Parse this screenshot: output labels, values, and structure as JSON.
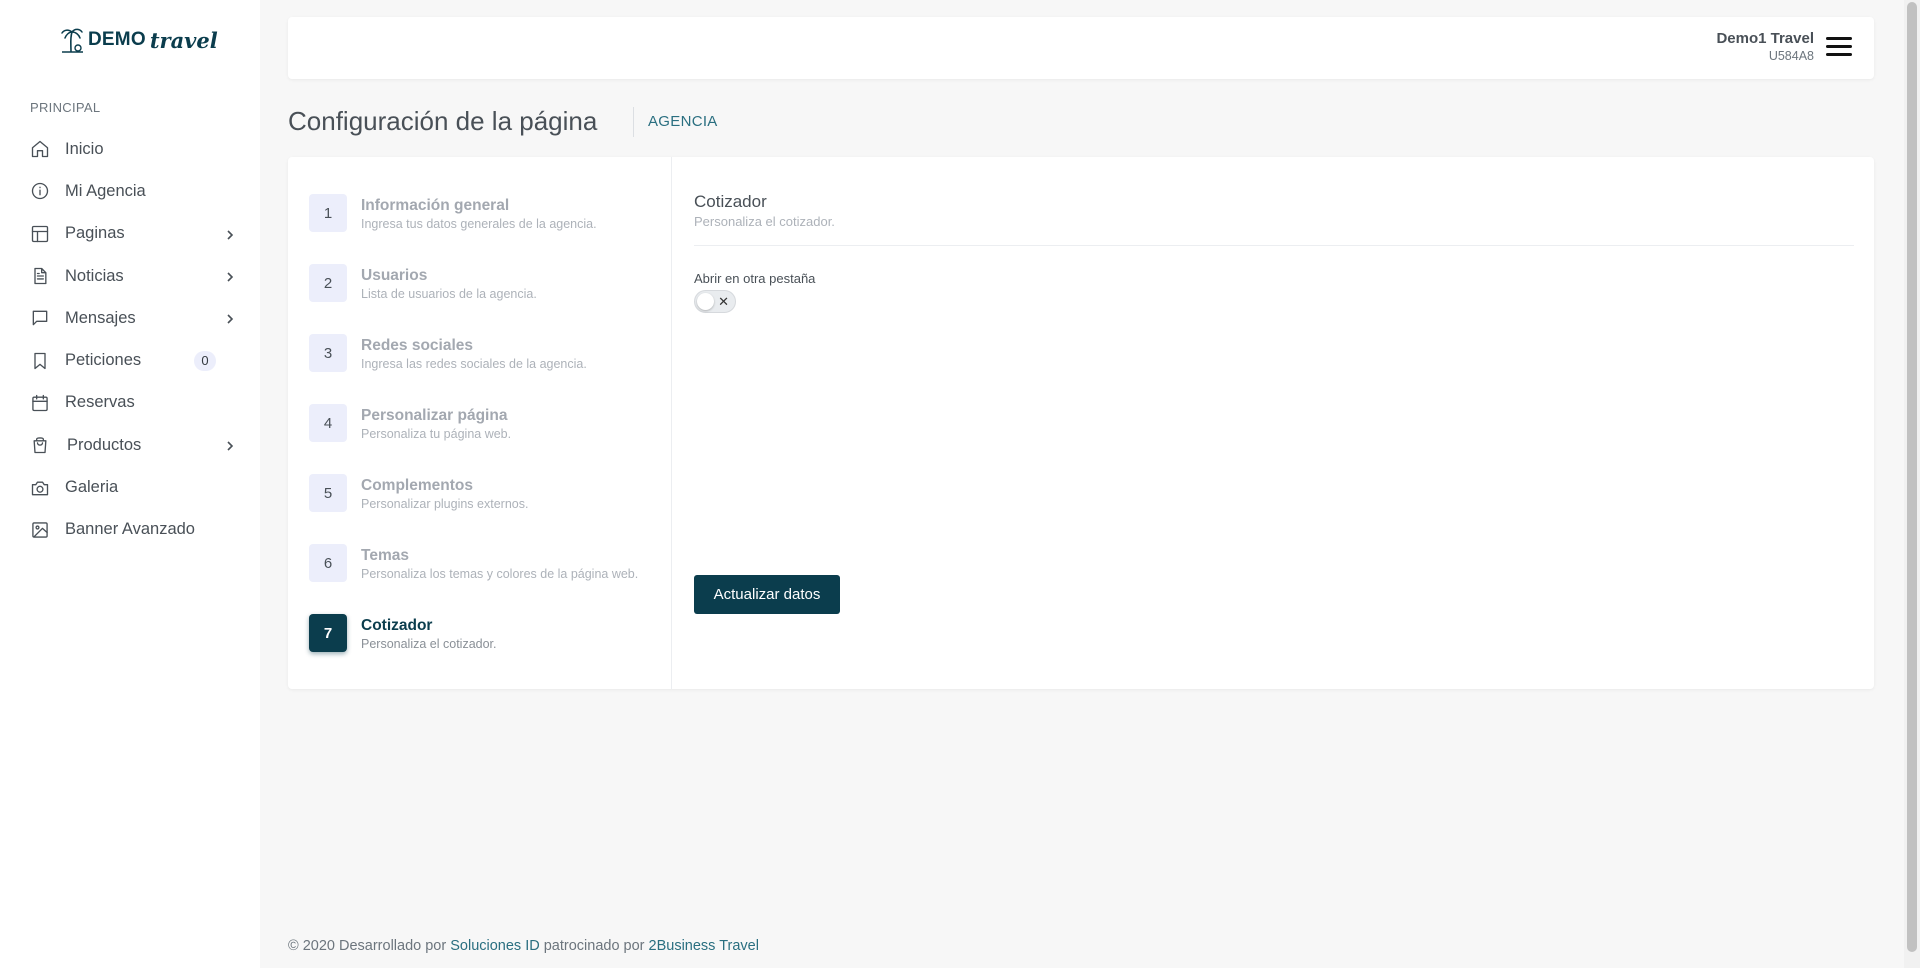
{
  "brand": {
    "demo": "DEMO",
    "travel": "travel"
  },
  "sidebar": {
    "section_title": "PRINCIPAL",
    "items": [
      {
        "label": "Inicio",
        "icon": "home-icon",
        "has_submenu": false
      },
      {
        "label": "Mi Agencia",
        "icon": "info-icon",
        "has_submenu": false
      },
      {
        "label": "Paginas",
        "icon": "layout-icon",
        "has_submenu": true
      },
      {
        "label": "Noticias",
        "icon": "file-text-icon",
        "has_submenu": true
      },
      {
        "label": "Mensajes",
        "icon": "message-icon",
        "has_submenu": true
      },
      {
        "label": "Peticiones",
        "icon": "bookmark-icon",
        "has_submenu": false,
        "badge": "0"
      },
      {
        "label": "Reservas",
        "icon": "calendar-icon",
        "has_submenu": false
      },
      {
        "label": "Productos",
        "icon": "shopping-bag-icon",
        "has_submenu": true
      },
      {
        "label": "Galeria",
        "icon": "camera-icon",
        "has_submenu": false
      },
      {
        "label": "Banner Avanzado",
        "icon": "image-icon",
        "has_submenu": false
      }
    ]
  },
  "header": {
    "user_name": "Demo1 Travel",
    "user_code": "U584A8"
  },
  "page": {
    "title": "Configuración de la página",
    "breadcrumb": "AGENCIA"
  },
  "steps": [
    {
      "num": "1",
      "title": "Información general",
      "desc": "Ingresa tus datos generales de la agencia."
    },
    {
      "num": "2",
      "title": "Usuarios",
      "desc": "Lista de usuarios de la agencia."
    },
    {
      "num": "3",
      "title": "Redes sociales",
      "desc": "Ingresa las redes sociales de la agencia."
    },
    {
      "num": "4",
      "title": "Personalizar página",
      "desc": "Personaliza tu página web."
    },
    {
      "num": "5",
      "title": "Complementos",
      "desc": "Personalizar plugins externos."
    },
    {
      "num": "6",
      "title": "Temas",
      "desc": "Personaliza los temas y colores de la página web."
    },
    {
      "num": "7",
      "title": "Cotizador",
      "desc": "Personaliza el cotizador.",
      "active": true
    }
  ],
  "content": {
    "title": "Cotizador",
    "desc": "Personaliza el cotizador.",
    "field_label": "Abrir en otra pestaña",
    "toggle_off_symbol": "✕",
    "button_label": "Actualizar datos"
  },
  "footer": {
    "prefix": "© 2020 Desarrollado por",
    "link1": "Soluciones ID",
    "middle": "patrocinado por",
    "link2": "2Business Travel"
  },
  "colors": {
    "primary": "#0b3d4d",
    "accent_link": "#2a6f80",
    "badge_bg": "#eceefb",
    "background": "#f7f7f7"
  }
}
